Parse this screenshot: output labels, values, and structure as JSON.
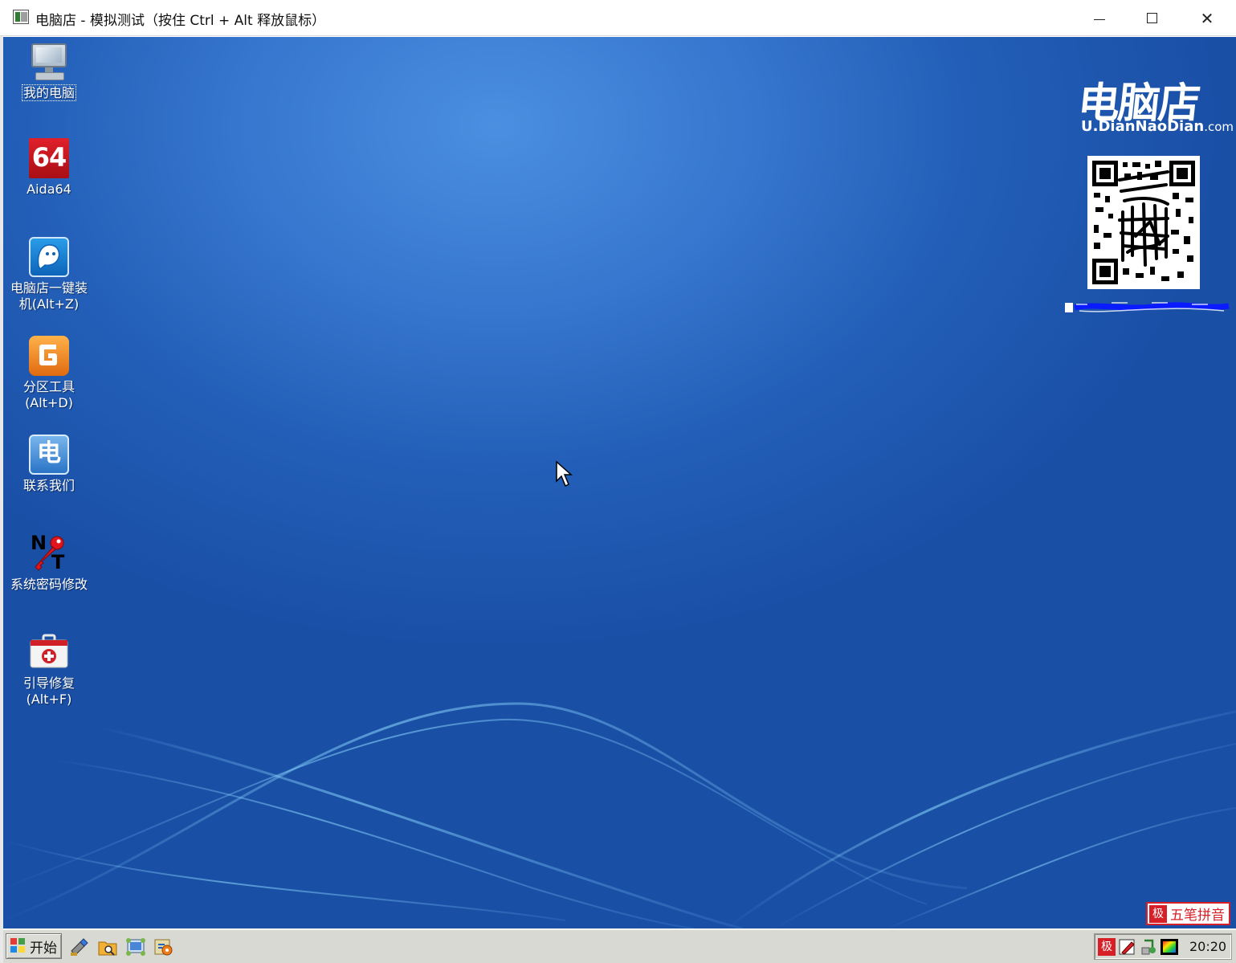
{
  "window": {
    "title": "电脑店 - 模拟测试（按住 Ctrl + Alt 释放鼠标）",
    "minimize_glyph": "",
    "close_glyph": "✕"
  },
  "desktop_icons": [
    {
      "label": "我的电脑",
      "icon": "computer-icon"
    },
    {
      "label": "Aida64",
      "icon": "aida64-icon",
      "glyph_text": "64"
    },
    {
      "label_lines": [
        "电脑店一键装",
        "机(Alt+Z)"
      ],
      "icon": "ghost-install-icon"
    },
    {
      "label_lines": [
        "分区工具",
        "(Alt+D)"
      ],
      "icon": "partition-tool-icon"
    },
    {
      "label": "联系我们",
      "icon": "contact-us-icon",
      "glyph_text": "电"
    },
    {
      "label": "系统密码修改",
      "icon": "nt-password-icon",
      "glyph_text_n": "N",
      "glyph_text_t": "T"
    },
    {
      "label_lines": [
        "引导修复",
        "(Alt+F)"
      ],
      "icon": "boot-repair-icon"
    }
  ],
  "brand": {
    "logo_text": "电脑店",
    "url_main": "U.DianNaoDian",
    "url_suffix": ".com"
  },
  "ime_bar": {
    "label": "五笔拼音",
    "icon_glyph": "极"
  },
  "taskbar": {
    "start_label": "开始",
    "clock": "20:20",
    "tray_icon_glyph": "极"
  },
  "colors": {
    "desktop_blue": "#2a67c0",
    "ime_red": "#d61f26"
  }
}
